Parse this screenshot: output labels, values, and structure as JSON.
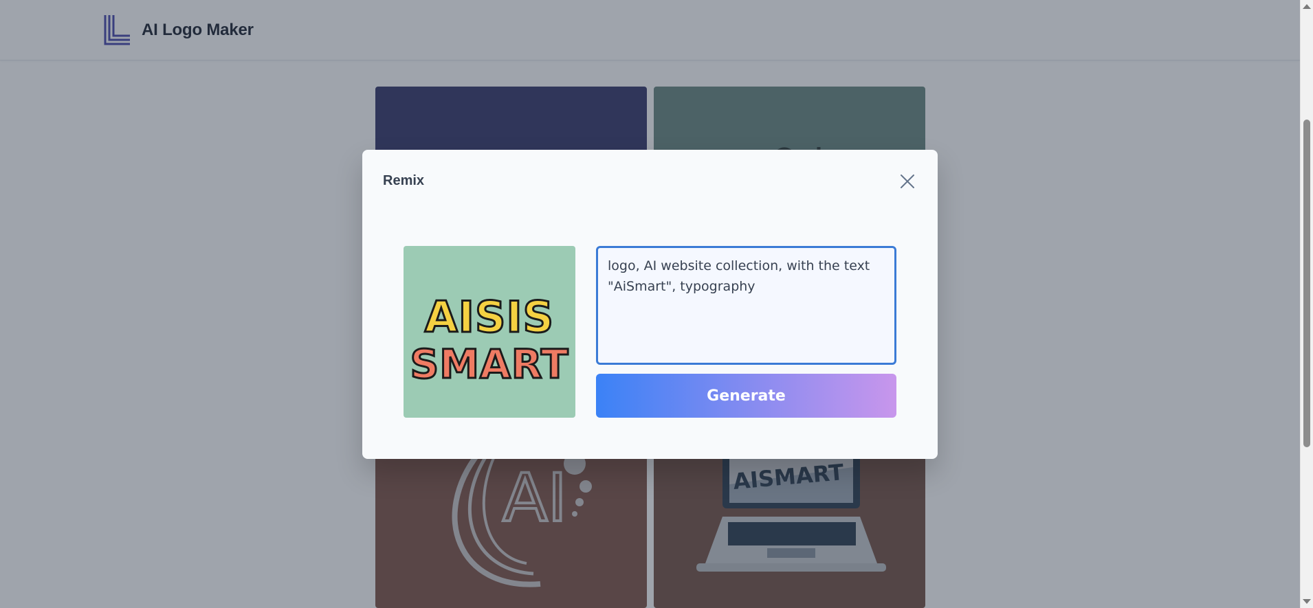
{
  "header": {
    "brand_name": "AI Logo Maker",
    "logo_icon": "letter-l-logo-icon",
    "brand_color": "#3f3fa8"
  },
  "gallery": {
    "tiles": [
      {
        "name": "navy-logo-tile",
        "background": "#2b2d62"
      },
      {
        "name": "sage-logo-tile",
        "background": "#61807a"
      },
      {
        "name": "ai-circle-logo-tile",
        "background": "#7a4b3e",
        "text": "AI"
      },
      {
        "name": "laptop-logo-tile",
        "background": "#6e4a3d",
        "text": "AISMART"
      }
    ]
  },
  "modal": {
    "title": "Remix",
    "close_icon": "close-icon",
    "preview_image_alt": "AiSis Smart typography logo",
    "preview_text_line1": "AISIS",
    "preview_text_line2": "SMART",
    "prompt_value": "logo, AI website collection, with the text \"AiSmart\", typography",
    "generate_label": "Generate",
    "accent_color": "#3b7bd6"
  }
}
